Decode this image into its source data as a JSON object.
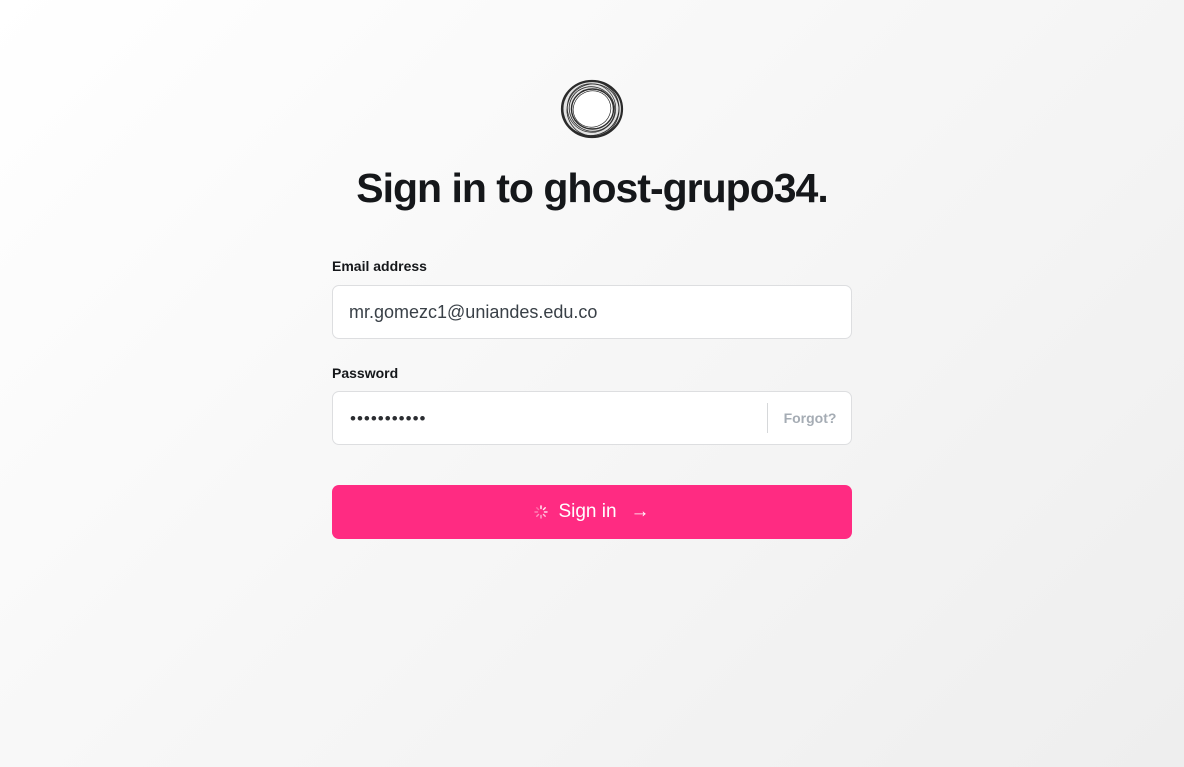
{
  "brand": {
    "logo_icon": "ghost-ring-logo-icon"
  },
  "page": {
    "title": "Sign in to ghost-grupo34."
  },
  "form": {
    "email_label": "Email address",
    "email_value": "mr.gomezc1@uniandes.edu.co",
    "password_label": "Password",
    "password_masked": "•••••••••••",
    "forgot_label": "Forgot?",
    "submit_label": "Sign in",
    "submit_arrow": "→",
    "submit_state": "loading"
  },
  "colors": {
    "accent": "#ff2b82",
    "text": "#15171a",
    "muted": "#a5acb4",
    "border": "#dddee0"
  }
}
